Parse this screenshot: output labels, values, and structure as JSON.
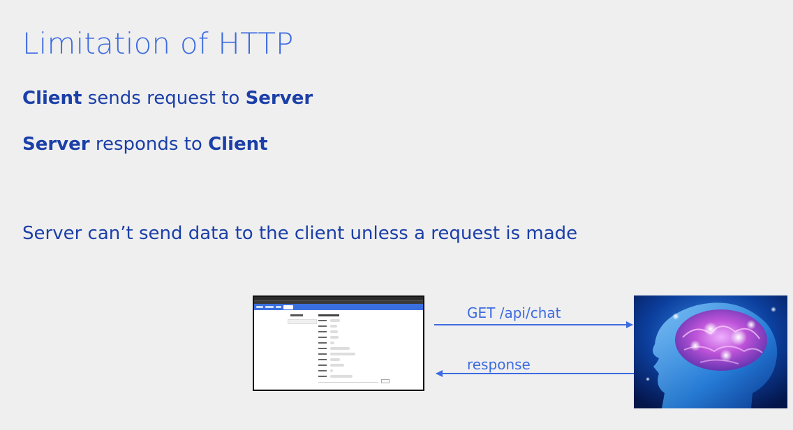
{
  "slide": {
    "title": "Limitation of HTTP",
    "line1": {
      "a": "Client",
      "b": " sends request to ",
      "c": "Server"
    },
    "line2": {
      "a": "Server",
      "b": " responds to ",
      "c": "Client"
    },
    "line3": "Server can’t send data to the client unless a request is made"
  },
  "diagram": {
    "request_label": "GET /api/chat",
    "response_label": "response",
    "client_image": "chat-app-screenshot",
    "server_image": "brain-head-illustration"
  },
  "colors": {
    "title": "#3d6be0",
    "text": "#1b3fa8",
    "arrow": "#3d6be0",
    "background": "#efefef"
  }
}
